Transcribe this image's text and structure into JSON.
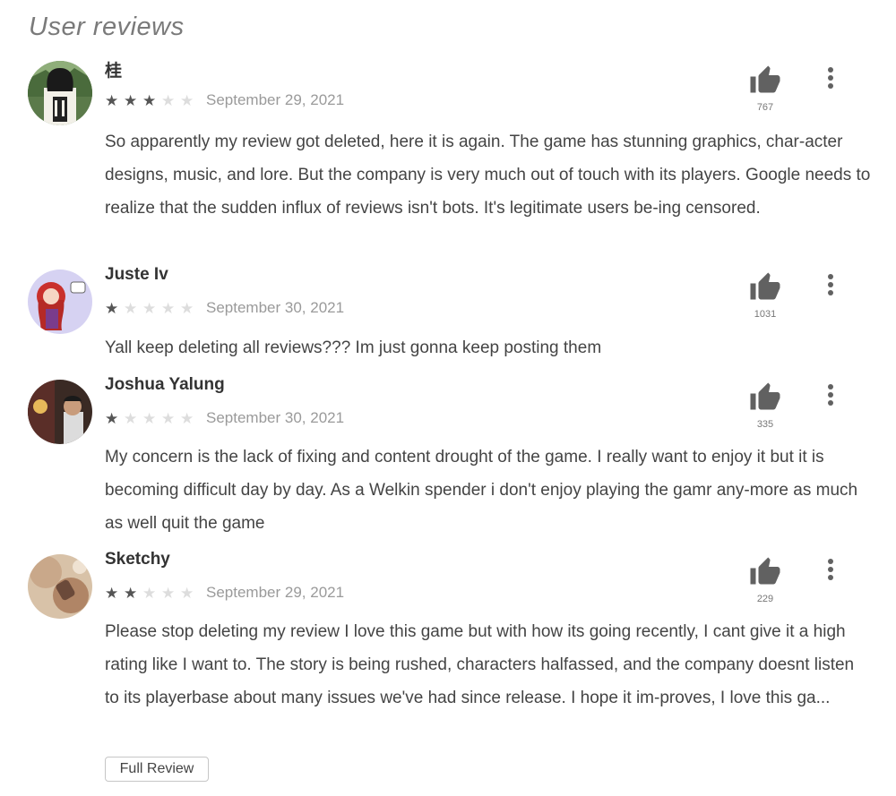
{
  "section_title": "User reviews",
  "full_review_label": "Full Review",
  "reviews": [
    {
      "author": "桂",
      "rating": 3,
      "max_rating": 5,
      "date": "September 29, 2021",
      "helpful_count": "767",
      "text": "So apparently my review got deleted, here it is again. The game has stunning graphics, char-acter designs, music, and lore. But the company is very much out of touch with its players. Google needs to realize that the sudden influx of reviews isn't bots. It's legitimate users be-ing censored."
    },
    {
      "author": "Juste Iv",
      "rating": 1,
      "max_rating": 5,
      "date": "September 30, 2021",
      "helpful_count": "1031",
      "text": "Yall keep deleting all reviews??? Im just gonna keep posting them"
    },
    {
      "author": "Joshua Yalung",
      "rating": 1,
      "max_rating": 5,
      "date": "September 30, 2021",
      "helpful_count": "335",
      "text": "My concern is the lack of fixing and content drought of the game. I really want to enjoy it but it is becoming difficult day by day. As a Welkin spender i don't enjoy playing the gamr any-more as much as well quit the game"
    },
    {
      "author": "Sketchy",
      "rating": 2,
      "max_rating": 5,
      "date": "September 29, 2021",
      "helpful_count": "229",
      "text": "Please stop deleting my review I love this game but with how its going recently, I cant give it a high rating like I want to. The story is being rushed, characters halfassed, and the company doesnt listen to its playerbase about many issues we've had since release. I hope it im-proves, I love this ga..."
    }
  ],
  "colors": {
    "star_filled": "#555555",
    "star_empty": "#dddddd",
    "date": "#9a9a9a",
    "thumb_icon": "#616161"
  },
  "icons": {
    "thumb": "thumbs-up-icon",
    "menu": "more-vertical-icon"
  }
}
